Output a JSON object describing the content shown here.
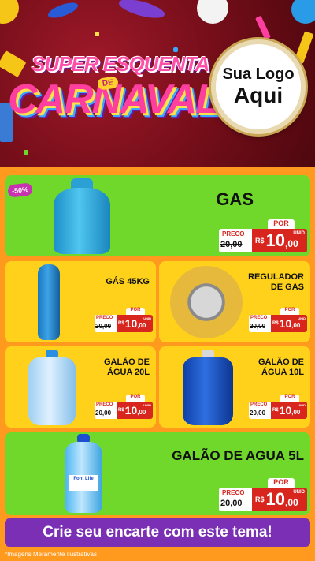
{
  "header": {
    "title_line1": "SUPER ESQUENTA",
    "title_de": "DE",
    "title_line2": "CARNAVAL",
    "logo_line1": "Sua Logo",
    "logo_line2": "Aqui"
  },
  "discount_badge": "-50%",
  "products": [
    {
      "name": "GAS",
      "preco_label": "PRECO",
      "old_price": "20,00",
      "old_prefix": "R$",
      "por_label": "POR",
      "currency": "R$",
      "price_int": "10",
      "price_dec": ",00",
      "unit": "UNID"
    },
    {
      "name": "GÁS 45KG",
      "preco_label": "PRECO",
      "old_price": "20,00",
      "old_prefix": "R$",
      "por_label": "POR",
      "currency": "R$",
      "price_int": "10",
      "price_dec": ",00",
      "unit": "UNID"
    },
    {
      "name": "REGULADOR DE GAS",
      "preco_label": "PRECO",
      "old_price": "20,00",
      "old_prefix": "R$",
      "por_label": "POR",
      "currency": "R$",
      "price_int": "10",
      "price_dec": ",00",
      "unit": "UNID"
    },
    {
      "name": "GALÃO DE ÁGUA 20L",
      "preco_label": "PRECO",
      "old_price": "20,00",
      "old_prefix": "R$",
      "por_label": "POR",
      "currency": "R$",
      "price_int": "10",
      "price_dec": ",00",
      "unit": "UNID"
    },
    {
      "name": "GALÃO DE ÁGUA 10L",
      "preco_label": "PRECO",
      "old_price": "20,00",
      "old_prefix": "R$",
      "por_label": "POR",
      "currency": "R$",
      "price_int": "10",
      "price_dec": ",00",
      "unit": "UNID"
    },
    {
      "name": "GALÃO DE AGUA 5L",
      "preco_label": "PRECO",
      "old_price": "20,00",
      "old_prefix": "R$",
      "por_label": "POR",
      "currency": "R$",
      "price_int": "10",
      "price_dec": ",00",
      "unit": "UNID"
    }
  ],
  "bottle_label": "Font Life",
  "cta_text": "Crie seu encarte com este tema!",
  "footnote": "*Imagens Meramente Ilustrativas",
  "colors": {
    "green": "#6fd82a",
    "yellow": "#ffd11a",
    "orange": "#ff9a1f",
    "red": "#d8261e",
    "purple": "#7a2fb4"
  }
}
